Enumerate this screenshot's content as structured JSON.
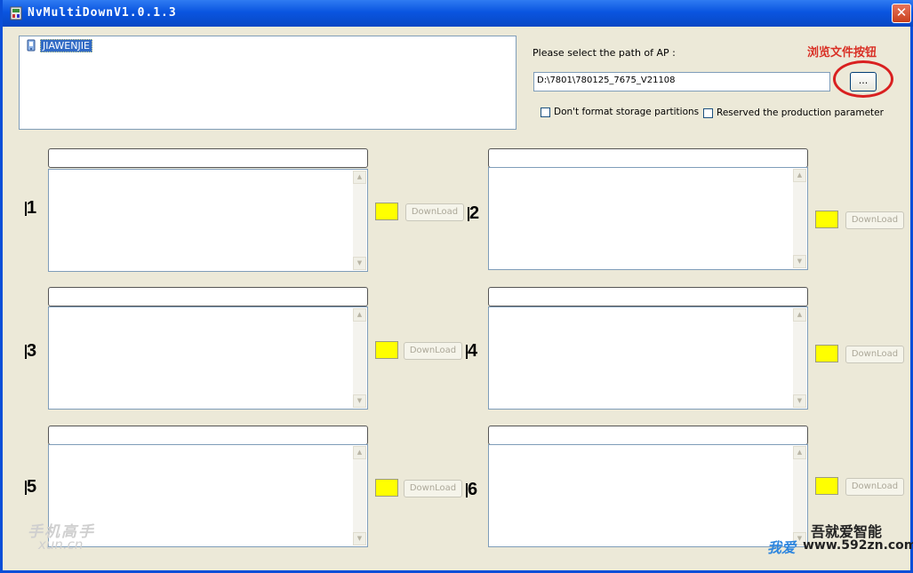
{
  "window": {
    "title": "NvMultiDownV1.0.1.3",
    "close_glyph": "✕"
  },
  "device_list": {
    "items": [
      "JIAWENJIE"
    ]
  },
  "path": {
    "label": "Please select the path of AP :",
    "value": "D:\\7801\\780125_7675_V21108",
    "browse_label": "...",
    "annotation": "浏览文件按钮"
  },
  "options": {
    "no_format": "Don't format storage partitions",
    "reserve_param": "Reserved the production parameter"
  },
  "slots": [
    {
      "number": "1",
      "title": "",
      "button": "DownLoad",
      "status_color": "#ffff00"
    },
    {
      "number": "2",
      "title": "",
      "button": "DownLoad",
      "status_color": "#ffff00"
    },
    {
      "number": "3",
      "title": "",
      "button": "DownLoad",
      "status_color": "#ffff00"
    },
    {
      "number": "4",
      "title": "",
      "button": "DownLoad",
      "status_color": "#ffff00"
    },
    {
      "number": "5",
      "title": "",
      "button": "DownLoad",
      "status_color": "#ffff00"
    },
    {
      "number": "6",
      "title": "",
      "button": "DownLoad",
      "status_color": "#ffff00"
    }
  ],
  "watermarks": {
    "left_top": "手机高手",
    "left_bottom": "xun.cn",
    "right_top": "吾就爱智能",
    "right_big": "我爱",
    "right_bottom": "www.592zn.com"
  }
}
